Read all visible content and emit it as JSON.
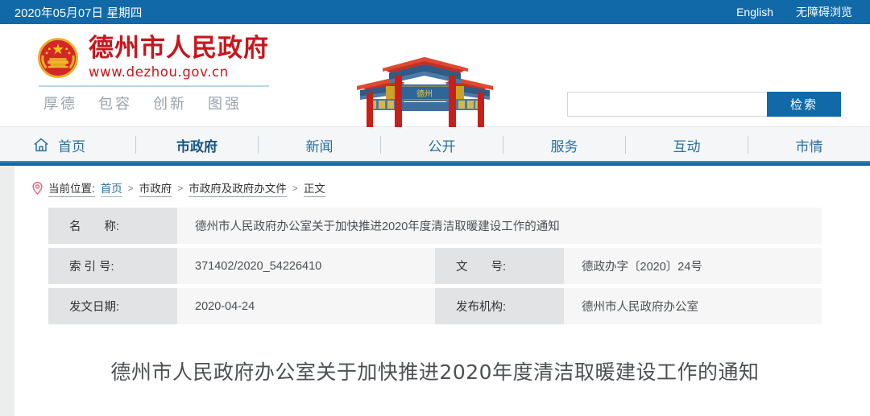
{
  "topbar": {
    "date": "2020年05月07日 星期四",
    "links": [
      {
        "label": "English",
        "name": "english-link"
      },
      {
        "label": "无障碍浏览",
        "name": "accessibility-link"
      }
    ]
  },
  "header": {
    "site_title": "德州市人民政府",
    "site_url": "www.dezhou.gov.cn",
    "motto": [
      "厚德",
      "包容",
      "创新",
      "图强"
    ],
    "emblem_icon": "national-emblem-icon",
    "archway_icon": "chinese-archway-image",
    "archway_plaque": "德州",
    "search": {
      "value": "",
      "placeholder": "",
      "button_label": "检索"
    }
  },
  "nav": {
    "home_icon": "home-icon",
    "items": [
      {
        "label": "首页",
        "active": false
      },
      {
        "label": "市政府",
        "active": true
      },
      {
        "label": "新闻",
        "active": false
      },
      {
        "label": "公开",
        "active": false
      },
      {
        "label": "服务",
        "active": false
      },
      {
        "label": "互动",
        "active": false
      },
      {
        "label": "市情",
        "active": false
      }
    ]
  },
  "breadcrumb": {
    "pin_icon": "location-pin-icon",
    "label": "当前位置:",
    "items": [
      "首页",
      "市政府",
      "市政府及政府办文件",
      "正文"
    ],
    "separator": ">"
  },
  "info_table": {
    "rows": [
      {
        "left_label": "名　　称:",
        "left_value": "德州市人民政府办公室关于加快推进2020年度清洁取暖建设工作的通知",
        "full_width": true
      },
      {
        "left_label": "索 引 号:",
        "left_value": "371402/2020_54226410",
        "right_label": "文　　号:",
        "right_value": "德政办字〔2020〕24号",
        "full_width": false
      },
      {
        "left_label": "发文日期:",
        "left_value": "2020-04-24",
        "right_label": "发布机构:",
        "right_value": "德州市人民政府办公室",
        "full_width": false
      }
    ]
  },
  "article": {
    "title": "德州市人民政府办公室关于加快推进2020年度清洁取暖建设工作的通知"
  },
  "colors": {
    "topbar_blue": "#1169a8",
    "brand_red": "#c7171d",
    "nav_text": "#2b6f9e",
    "label_bg": "#e2e3e4",
    "value_bg": "#f6f6f6"
  }
}
